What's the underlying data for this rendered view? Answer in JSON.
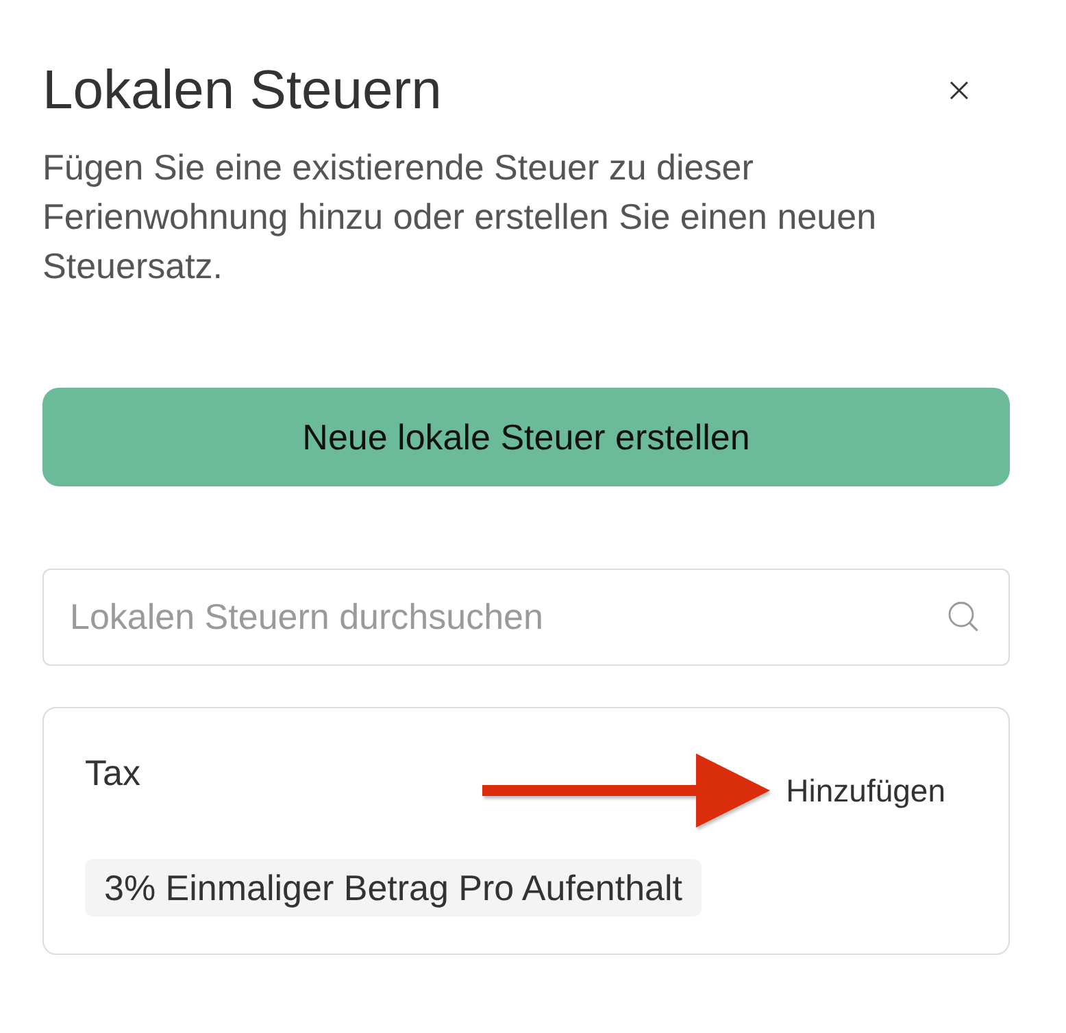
{
  "dialog": {
    "title": "Lokalen Steuern",
    "description": "Fügen Sie eine existierende Steuer zu dieser Ferienwohnung hinzu oder erstellen Sie einen neuen Steuersatz."
  },
  "primary_button": {
    "label": "Neue lokale Steuer erstellen"
  },
  "search": {
    "placeholder": "Lokalen Steuern durchsuchen"
  },
  "taxes": [
    {
      "name": "Tax",
      "action": "Hinzufügen",
      "badge": "3% Einmaliger Betrag Pro Aufenthalt",
      "annotation": {
        "kind": "arrow"
      }
    }
  ]
}
